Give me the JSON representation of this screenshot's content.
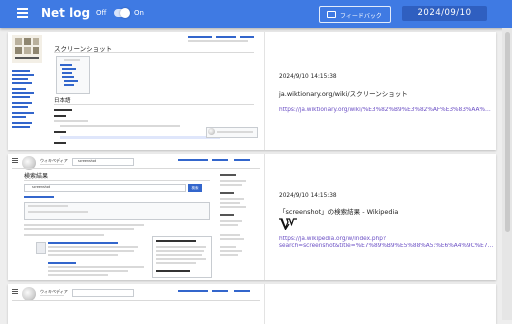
{
  "app": {
    "title": "Net log",
    "toggle_off": "Off",
    "toggle_on": "On",
    "feedback_label": "フィードバック",
    "date": "2024/09/10",
    "menu_icon": "hamburger-menu-icon",
    "feedback_icon": "comment-icon"
  },
  "colors": {
    "appbar": "#3f7ae3",
    "date_box": "#2f5fc0",
    "link": "#6a4ec4",
    "background": "#eeeeee"
  },
  "entries": [
    {
      "timestamp": "2024/9/10 14:15:38",
      "title": "ja.wiktionary.org/wiki/スクリーンショット",
      "url": "https://ja.wiktionary.org/wiki/%E3%82%B9%E3%82%AF%E3%83%AA%E3%83%BC...",
      "shot": {
        "heading": "スクリーンショット",
        "lang": "日本語"
      }
    },
    {
      "timestamp": "2024/9/10 14:15:38",
      "title": "「screenshot」の検索結果 - Wikipedia",
      "url": "https://ja.wikipedia.org/w/index.php?",
      "url2": "search=screenshot&title=%E7%89%B9%E5%88%A5:%E6%A4%9C%E7%B4%A2&ns...",
      "shot": {
        "site": "ウィキペディア",
        "search_value": "screenshot",
        "heading": "検索結果",
        "search_button": "検索"
      }
    },
    {
      "shot": {
        "site": "ウィキペディア"
      }
    }
  ]
}
